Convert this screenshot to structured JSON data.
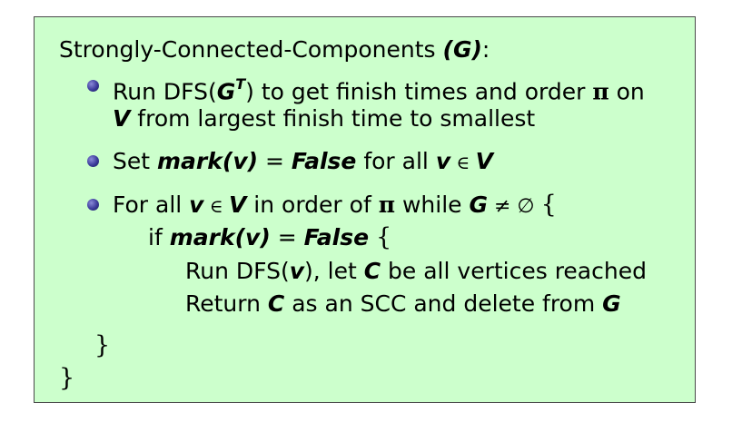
{
  "algorithm": {
    "name": "Strongly-Connected-Components",
    "param": "G",
    "header_tail": ":",
    "bullets": [
      {
        "line1": {
          "pre": "Run DFS(",
          "g": "G",
          "sup": "T",
          "post": ") to get finish times and order ",
          "pi": "π",
          "tail": " on"
        },
        "line2": {
          "v": "V",
          "text": " from largest finish time to smallest"
        }
      },
      {
        "pre": "Set ",
        "mark": "mark",
        "open": "(",
        "v": "v",
        "close": ")",
        "eq": " = ",
        "false": "False",
        "mid": " for all ",
        "v2": "v",
        "in": " ∈ ",
        "V": "V"
      },
      {
        "pre": "For all ",
        "v": "v",
        "in": " ∈ ",
        "V": "V",
        "mid": " in order of ",
        "pi": "π",
        "while": " while ",
        "G": "G",
        "neq": " ≠ ∅ ",
        "brace": "{"
      }
    ],
    "if_line": {
      "pre": "if ",
      "mark": "mark",
      "open": "(",
      "v": "v",
      "close": ")",
      "eq": " = ",
      "false": "False",
      "brace": "{"
    },
    "inner1": {
      "pre": "Run DFS(",
      "v": "v",
      "mid": "), let ",
      "C": "C",
      "post": " be all vertices reached"
    },
    "inner2": {
      "pre": "Return ",
      "C": "C",
      "mid": " as an SCC and delete from ",
      "G": "G"
    },
    "close_inner": "}",
    "close_outer": "}"
  }
}
